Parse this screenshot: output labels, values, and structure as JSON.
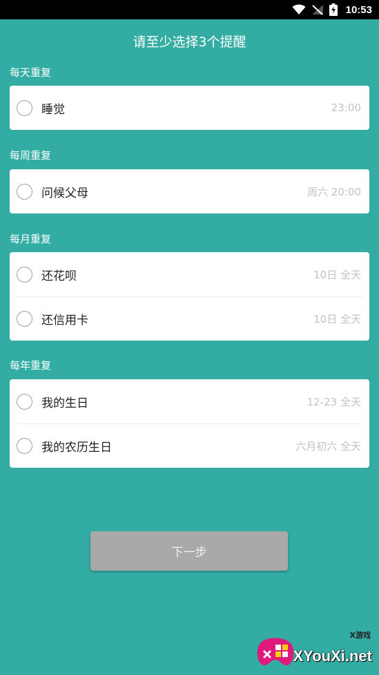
{
  "status_bar": {
    "time": "10:53"
  },
  "page": {
    "title": "请至少选择3个提醒"
  },
  "sections": [
    {
      "label": "每天重复",
      "items": [
        {
          "title": "睡觉",
          "time": "23:00"
        }
      ]
    },
    {
      "label": "每周重复",
      "items": [
        {
          "title": "问候父母",
          "time": "周六 20:00"
        }
      ]
    },
    {
      "label": "每月重复",
      "items": [
        {
          "title": "还花呗",
          "time": "10日 全天"
        },
        {
          "title": "还信用卡",
          "time": "10日 全天"
        }
      ]
    },
    {
      "label": "每年重复",
      "items": [
        {
          "title": "我的生日",
          "time": "12-23 全天"
        },
        {
          "title": "我的农历生日",
          "time": "六月初六 全天"
        }
      ]
    }
  ],
  "next_button": {
    "label": "下一步"
  },
  "watermark": {
    "small": "X游戏",
    "text": "XYouXi.net"
  },
  "colors": {
    "background": "#33ada3",
    "button": "#a9a9a9",
    "time_text": "#c2c2c2"
  }
}
